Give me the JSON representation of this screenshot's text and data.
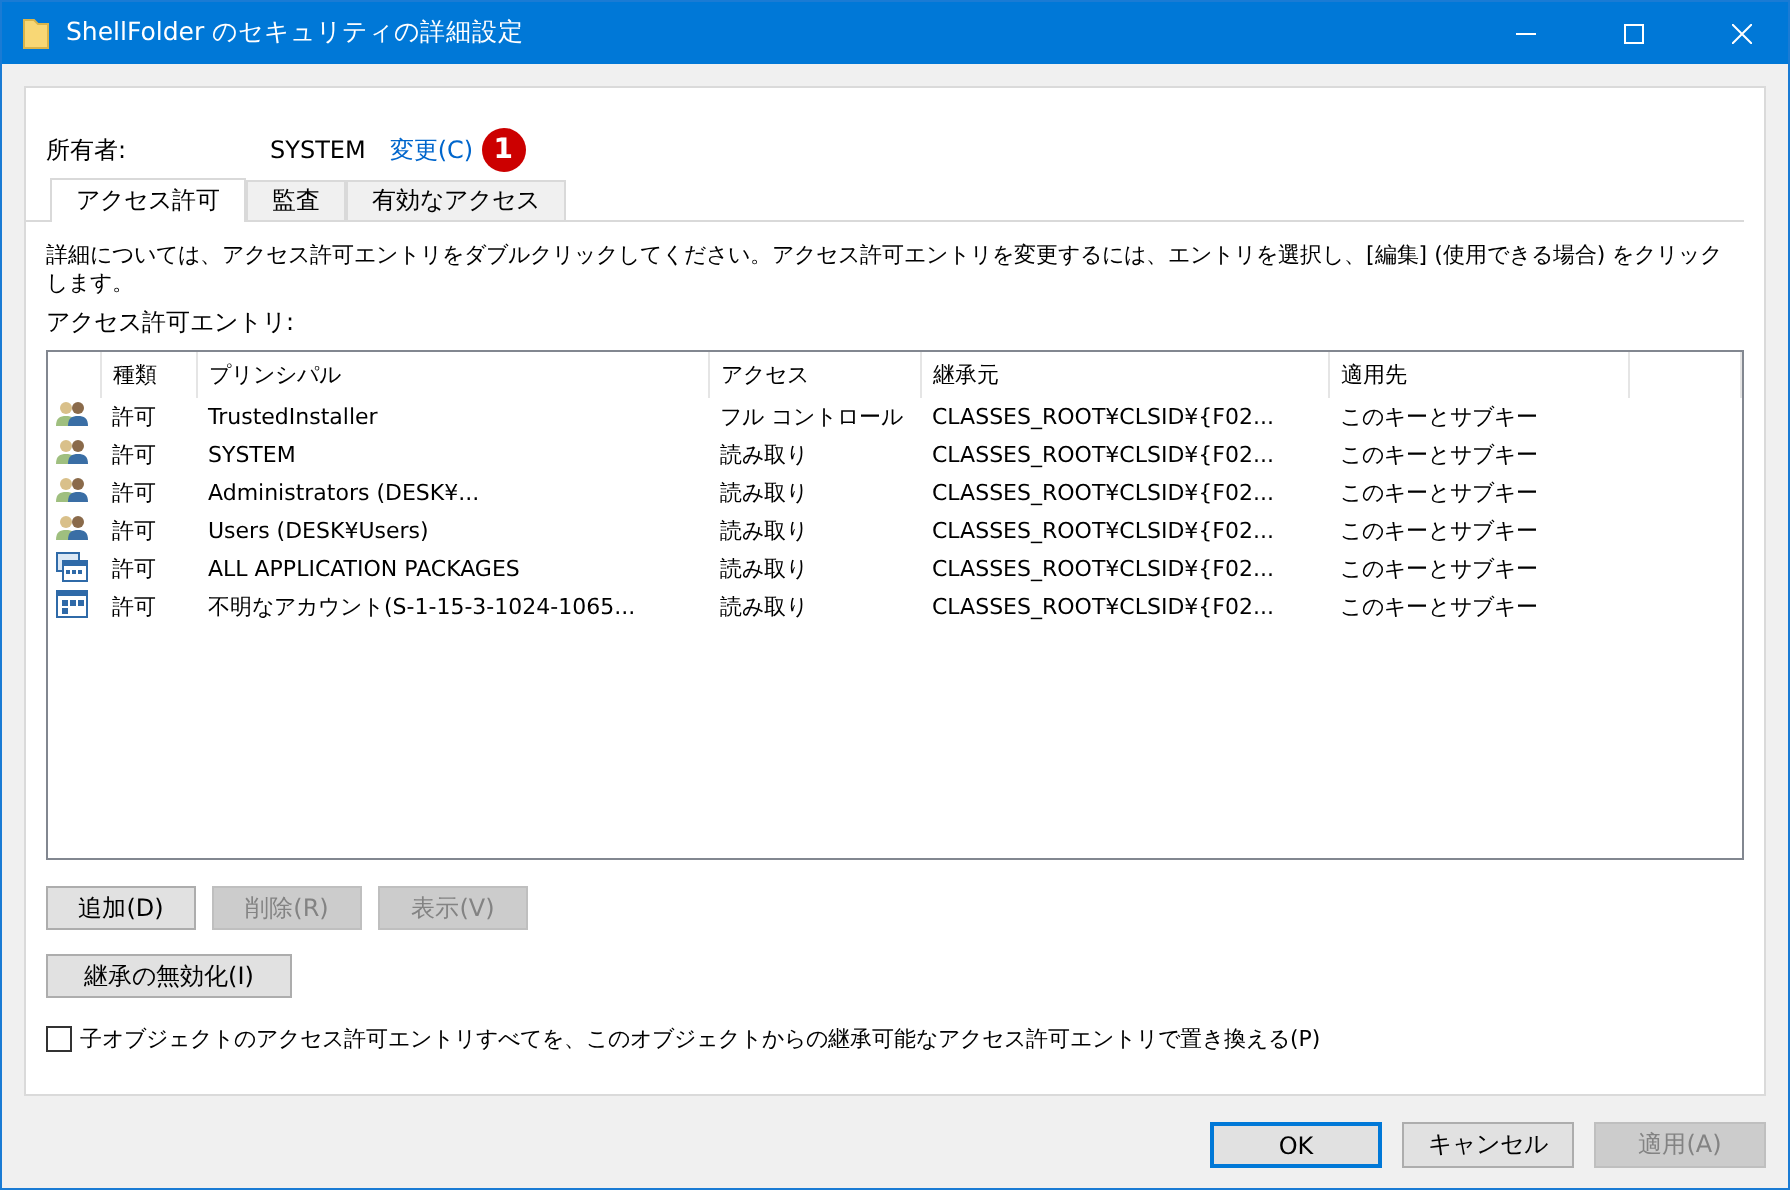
{
  "window": {
    "title": "ShellFolder のセキュリティの詳細設定"
  },
  "owner": {
    "label": "所有者:",
    "value": "SYSTEM",
    "link": "変更(C)",
    "badge": "1"
  },
  "tabs": [
    {
      "label": "アクセス許可",
      "selected": true
    },
    {
      "label": "監査",
      "selected": false
    },
    {
      "label": "有効なアクセス",
      "selected": false
    }
  ],
  "description": "詳細については、アクセス許可エントリをダブルクリックしてください。アクセス許可エントリを変更するには、エントリを選択し、[編集] (使用できる場合) をクリックします。",
  "list_label": "アクセス許可エントリ:",
  "table": {
    "columns": [
      "種類",
      "プリンシパル",
      "アクセス",
      "継承元",
      "適用先"
    ],
    "rows": [
      {
        "kind": "group",
        "type": "許可",
        "principal": "TrustedInstaller",
        "access": "フル コントロール",
        "inherited_from": "CLASSES_ROOT¥CLSID¥{F02...",
        "applies_to": "このキーとサブキー"
      },
      {
        "kind": "group",
        "type": "許可",
        "principal": "SYSTEM",
        "access": "読み取り",
        "inherited_from": "CLASSES_ROOT¥CLSID¥{F02...",
        "applies_to": "このキーとサブキー"
      },
      {
        "kind": "group",
        "type": "許可",
        "principal": "Administrators (DESK¥...",
        "access": "読み取り",
        "inherited_from": "CLASSES_ROOT¥CLSID¥{F02...",
        "applies_to": "このキーとサブキー"
      },
      {
        "kind": "group",
        "type": "許可",
        "principal": "Users (DESK¥Users)",
        "access": "読み取り",
        "inherited_from": "CLASSES_ROOT¥CLSID¥{F02...",
        "applies_to": "このキーとサブキー"
      },
      {
        "kind": "package",
        "type": "許可",
        "principal": "ALL APPLICATION PACKAGES",
        "access": "読み取り",
        "inherited_from": "CLASSES_ROOT¥CLSID¥{F02...",
        "applies_to": "このキーとサブキー"
      },
      {
        "kind": "app",
        "type": "許可",
        "principal": "不明なアカウント(S-1-15-3-1024-1065...",
        "access": "読み取り",
        "inherited_from": "CLASSES_ROOT¥CLSID¥{F02...",
        "applies_to": "このキーとサブキー"
      }
    ]
  },
  "entry_buttons": [
    {
      "label": "追加(D)",
      "disabled": false
    },
    {
      "label": "削除(R)",
      "disabled": true
    },
    {
      "label": "表示(V)",
      "disabled": true
    }
  ],
  "inheritance_button": {
    "label": "継承の無効化(I)"
  },
  "replace_checkbox": {
    "label": "子オブジェクトのアクセス許可エントリすべてを、このオブジェクトからの継承可能なアクセス許可エントリで置き換える(P)",
    "checked": false
  },
  "dialog_buttons": [
    {
      "label": "OK",
      "disabled": false,
      "default": true
    },
    {
      "label": "キャンセル",
      "disabled": false,
      "default": false
    },
    {
      "label": "適用(A)",
      "disabled": true,
      "default": false
    }
  ]
}
